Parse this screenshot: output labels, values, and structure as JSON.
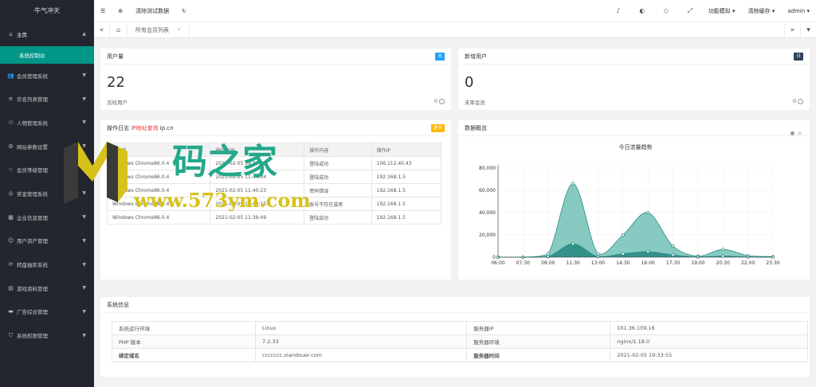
{
  "sidebar": {
    "brand": "牛气冲天",
    "home": "主页",
    "home_sub": "系统控制台",
    "items": [
      {
        "icon": "users-icon",
        "glyph": "👥",
        "label": "会员管理系统"
      },
      {
        "icon": "list-icon",
        "glyph": "≡",
        "label": "实名列表管理"
      },
      {
        "icon": "person-icon",
        "glyph": "⚇",
        "label": "人物管理系统"
      },
      {
        "icon": "gear-icon",
        "glyph": "⚙",
        "label": "网站参数设置"
      },
      {
        "icon": "star-icon",
        "glyph": "☆",
        "label": "会员等级管理"
      },
      {
        "icon": "coin-icon",
        "glyph": "◎",
        "label": "奖金管理系统"
      },
      {
        "icon": "building-icon",
        "glyph": "▦",
        "label": "企业信息管理"
      },
      {
        "icon": "user-icon",
        "glyph": "☺",
        "label": "用户资产管理"
      },
      {
        "icon": "refresh-icon",
        "glyph": "⟳",
        "label": "转盘抽奖系统"
      },
      {
        "icon": "doc-icon",
        "glyph": "▤",
        "label": "游戏资料管理"
      },
      {
        "icon": "ad-icon",
        "glyph": "▬",
        "label": "广告综合管理"
      },
      {
        "icon": "shield-icon",
        "glyph": "⛉",
        "label": "系统权限管理"
      }
    ]
  },
  "header": {
    "clear_test": "清除测试数据",
    "func_mode": "功能模拟",
    "clear_cache": "清除缓存",
    "user": "admin"
  },
  "tabs": {
    "active": "所有会员列表"
  },
  "cards": {
    "users": {
      "title": "用户量",
      "badge": "总",
      "badge_color": "#1e9fff",
      "count": "22",
      "foot_label": "冻结用户",
      "foot_value": "0"
    },
    "new_users": {
      "title": "新增用户",
      "badge": "日",
      "badge_color": "#2f4056",
      "count": "0",
      "foot_label": "未审会员",
      "foot_value": "0"
    },
    "log": {
      "title_prefix": "操作日志",
      "title_link": "IP地址查询",
      "title_suffix": "ip.cn",
      "badge": "更多",
      "badge_color": "#ffb800",
      "columns": [
        "用户名",
        "操作时间",
        "操作内容",
        "操作IP"
      ],
      "rows": [
        [
          "Windows Chrome86.0.4",
          "2021-02-05 19:33:53",
          "登陆成功",
          "106.112.40.43"
        ],
        [
          "Windows Chrome86.0.4",
          "2021-02-05 11:46:34",
          "登陆成功",
          "192.168.1.5"
        ],
        [
          "Windows Chrome86.0.4",
          "2021-02-05 11:40:23",
          "密码错误",
          "192.168.1.5"
        ],
        [
          "Windows Chrome86.0.4",
          "2021-02-05 11:40:15",
          "账号不存在或密",
          "192.168.1.5"
        ],
        [
          "Windows Chrome86.0.4",
          "2021-02-05 11:39:49",
          "登陆成功",
          "192.168.1.5"
        ]
      ]
    },
    "overview": {
      "title": "数据概览"
    },
    "sysinfo": {
      "title": "系统信息",
      "rows": [
        [
          "系统运行环境",
          "Linux",
          "服务器IP",
          "101.36.109.16"
        ],
        [
          "PHP 版本",
          "7.2.33",
          "服务器环境",
          "nginx/1.18.0"
        ],
        [
          "绑定域名",
          "ccccccc.xiandouer.com",
          "服务器时间",
          "2021-02-05 19:33:55"
        ]
      ]
    }
  },
  "watermark": {
    "text1": "码之家",
    "text2": "www.573ym.com"
  },
  "chart_data": {
    "type": "area",
    "title": "今日流量趋势",
    "x": [
      "06:00",
      "07:30",
      "09:00",
      "11:30",
      "13:00",
      "14:30",
      "16:00",
      "17:30",
      "19:00",
      "20:30",
      "22:00",
      "23:30"
    ],
    "ylim": [
      0,
      80000
    ],
    "yticks": [
      "0",
      "20,000",
      "40,000",
      "60,000",
      "80,000"
    ],
    "series": [
      {
        "name": "",
        "color": "#5fb8ad",
        "values": [
          0,
          0,
          3000,
          66000,
          3000,
          20000,
          40000,
          10000,
          1000,
          7000,
          1500,
          500
        ]
      },
      {
        "name": "",
        "color": "#2b8c84",
        "values": [
          0,
          0,
          500,
          12000,
          500,
          3000,
          5000,
          2000,
          200,
          1000,
          200,
          100
        ]
      }
    ],
    "grid": true
  }
}
